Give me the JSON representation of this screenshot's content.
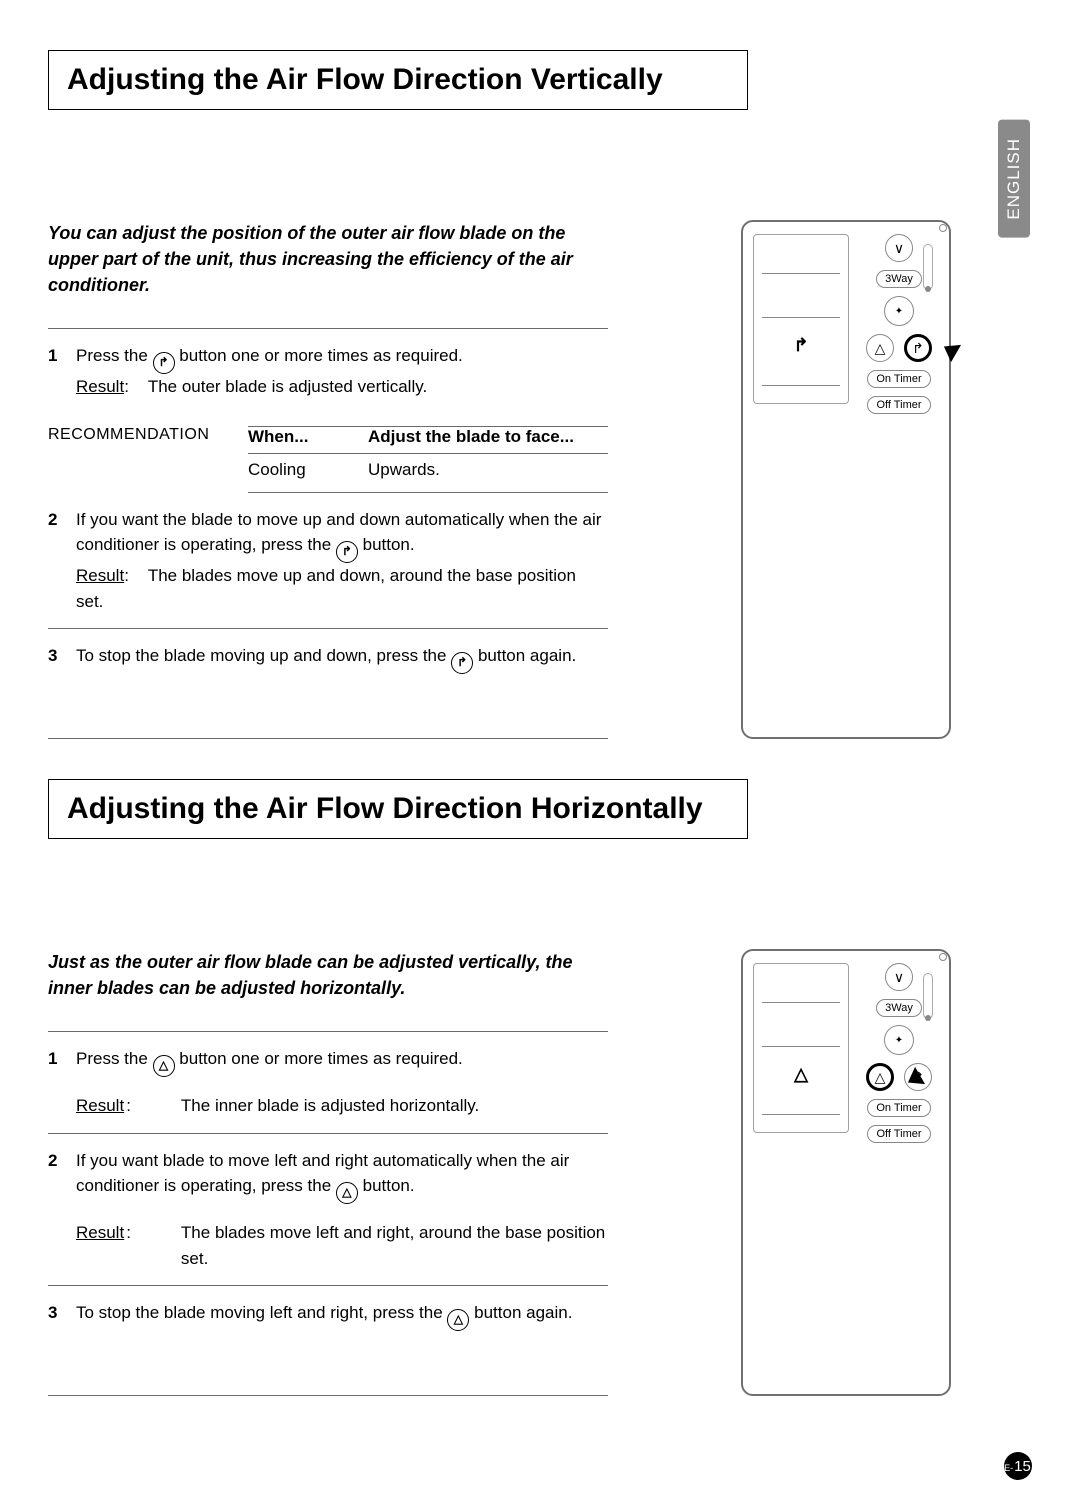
{
  "language_tab": "ENGLISH",
  "page_number": "15",
  "page_prefix": "E-",
  "icons": {
    "vertical_swing_glyph": "↱",
    "horizontal_swing_glyph": "△"
  },
  "remote": {
    "three_way_label": "3Way",
    "on_timer_label": "On Timer",
    "off_timer_label": "Off Timer",
    "down_glyph": "∨"
  },
  "section1": {
    "title": "Adjusting the Air Flow Direction Vertically",
    "intro": "You can adjust the position of the outer air flow blade on the upper part of the unit, thus increasing the efficiency of the air conditioner.",
    "step1_a": "Press the",
    "step1_b": "button one or more times as required.",
    "step1_result_label": "Result",
    "step1_result_text": "The outer blade is adjusted vertically.",
    "rec_label": "RECOMMENDATION",
    "rec_head_when": "When...",
    "rec_head_adjust": "Adjust the blade to face...",
    "rec_row_when": "Cooling",
    "rec_row_adjust": "Upwards.",
    "step2_a": "If you want the blade to move up and down automatically when the air conditioner is operating, press the",
    "step2_b": "button.",
    "step2_result_label": "Result",
    "step2_result_text": "The blades move up and down, around the base position set.",
    "step3_a": "To stop the blade moving up and down, press the",
    "step3_b": "button again."
  },
  "section2": {
    "title": "Adjusting the Air Flow Direction Horizontally",
    "intro": "Just as the outer air flow blade can be adjusted vertically, the inner blades can be adjusted horizontally.",
    "step1_a": "Press the",
    "step1_b": "button one or more times as required.",
    "step1_result_label": "Result",
    "step1_result_text": "The inner blade is adjusted horizontally.",
    "step2_a": "If you want blade to move left and right automatically when the air conditioner is operating, press the",
    "step2_b": "button.",
    "step2_result_label": "Result",
    "step2_result_text": "The blades move left and right, around the base position set.",
    "step3_a": "To stop the blade moving left and right, press the",
    "step3_b": "button again."
  }
}
